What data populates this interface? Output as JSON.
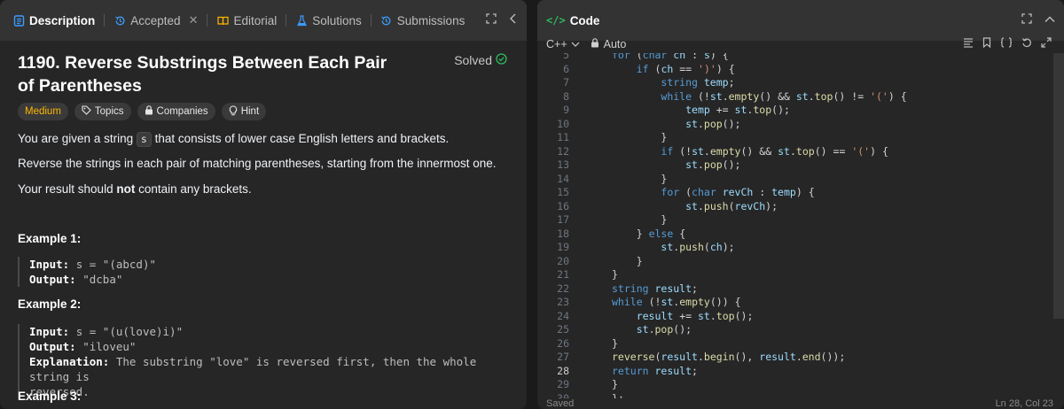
{
  "tabs": [
    {
      "label": "Description",
      "icon": "description-icon",
      "active": true
    },
    {
      "label": "Accepted",
      "icon": "history-icon",
      "closable": true
    },
    {
      "label": "Editorial",
      "icon": "book-icon"
    },
    {
      "label": "Solutions",
      "icon": "flask-icon"
    },
    {
      "label": "Submissions",
      "icon": "history-icon"
    }
  ],
  "problem": {
    "title": "1190. Reverse Substrings Between Each Pair of Parentheses",
    "status": "Solved",
    "difficulty": "Medium",
    "tags": [
      "Topics",
      "Companies",
      "Hint"
    ],
    "desc": {
      "p1_pre": "You are given a string",
      "p1_code": "s",
      "p1_post": "that consists of lower case English letters and brackets.",
      "p2": "Reverse the strings in each pair of matching parentheses, starting from the innermost one.",
      "p3_pre": "Your result should",
      "p3_bold": "not",
      "p3_post": "contain any brackets."
    },
    "examples": [
      {
        "title": "Example 1:",
        "input_label": "Input:",
        "input": "s = \"(abcd)\"",
        "output_label": "Output:",
        "output": "\"dcba\""
      },
      {
        "title": "Example 2:",
        "input_label": "Input:",
        "input": "s = \"(u(love)i)\"",
        "output_label": "Output:",
        "output": "\"iloveu\"",
        "expl_label": "Explanation:",
        "expl": "The substring \"love\" is reversed first, then the whole string is",
        "expl2": "reversed."
      },
      {
        "title": "Example 3:"
      }
    ]
  },
  "code": {
    "title": "Code",
    "language": "C++",
    "mode": "Auto",
    "status": "Saved",
    "cursor": "Ln 28, Col 23",
    "lines": [
      {
        "n": "5",
        "t": "    for (char ch : s) {"
      },
      {
        "n": "6",
        "t": "        if (ch == ')') {"
      },
      {
        "n": "7",
        "t": "            string temp;"
      },
      {
        "n": "8",
        "t": "            while (!st.empty() && st.top() != '(') {"
      },
      {
        "n": "9",
        "t": "                temp += st.top();"
      },
      {
        "n": "10",
        "t": "                st.pop();"
      },
      {
        "n": "11",
        "t": "            }"
      },
      {
        "n": "12",
        "t": "            if (!st.empty() && st.top() == '(') {"
      },
      {
        "n": "13",
        "t": "                st.pop();"
      },
      {
        "n": "14",
        "t": "            }"
      },
      {
        "n": "15",
        "t": "            for (char revCh : temp) {"
      },
      {
        "n": "16",
        "t": "                st.push(revCh);"
      },
      {
        "n": "17",
        "t": "            }"
      },
      {
        "n": "18",
        "t": "        } else {"
      },
      {
        "n": "19",
        "t": "            st.push(ch);"
      },
      {
        "n": "20",
        "t": "        }"
      },
      {
        "n": "21",
        "t": "    }"
      },
      {
        "n": "22",
        "t": "    string result;"
      },
      {
        "n": "23",
        "t": "    while (!st.empty()) {"
      },
      {
        "n": "24",
        "t": "        result += st.top();"
      },
      {
        "n": "25",
        "t": "        st.pop();"
      },
      {
        "n": "26",
        "t": "    }"
      },
      {
        "n": "27",
        "t": "    reverse(result.begin(), result.end());"
      },
      {
        "n": "28",
        "t": "    return result;"
      },
      {
        "n": "29",
        "t": "}"
      },
      {
        "n": "30",
        "t": "};"
      }
    ]
  }
}
